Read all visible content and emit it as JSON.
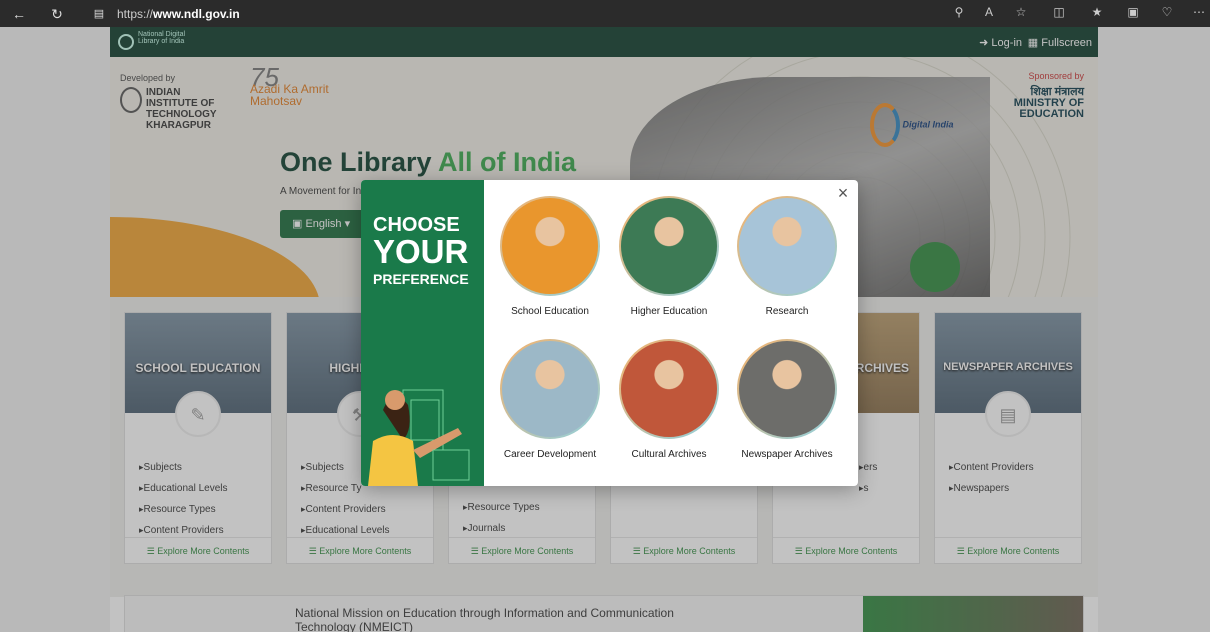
{
  "browser": {
    "url_prefix": "https://",
    "url_domain": "www.ndl.gov.in"
  },
  "topbar": {
    "logo_text": "National Digital Library of India",
    "login": "Log-in",
    "fullscreen": "Fullscreen"
  },
  "hero": {
    "developed_by": "Developed by",
    "iit_name": "INDIAN INSTITUTE OF TECHNOLOGY KHARAGPUR",
    "azadi_num": "75",
    "azadi_text": "Azadi Ka Amrit Mahotsav",
    "digital_india": "Digital India",
    "sponsored_by": "Sponsored by",
    "ministry": "शिक्षा मंत्रालय MINISTRY OF EDUCATION",
    "headline_a": "One Library ",
    "headline_b": "All of India",
    "subline": "A Movement for In",
    "language": "English"
  },
  "cards": [
    {
      "title": "SCHOOL EDUCATION",
      "links": [
        "Subjects",
        "Educational Levels",
        "Resource Types",
        "Content Providers"
      ],
      "explore": "Explore More Contents"
    },
    {
      "title": "HIGHER EI",
      "links": [
        "Subjects",
        "Resource Ty",
        "Content Providers",
        "Educational Levels"
      ],
      "explore": "Explore More Contents"
    },
    {
      "title": "",
      "links": [
        "",
        "",
        "Resource Types",
        "Journals"
      ],
      "explore": "Explore More Contents"
    },
    {
      "title": "",
      "links": [],
      "explore": "Explore More Contents"
    },
    {
      "title": "RCHIVES",
      "links": [
        "ers",
        "s"
      ],
      "explore": "Explore More Contents"
    },
    {
      "title": "NEWSPAPER ARCHIVES",
      "links": [
        "Content Providers",
        "Newspapers"
      ],
      "explore": "Explore More Contents"
    }
  ],
  "nmeict": {
    "text": "National Mission on Education through Information and Communication Technology (NMEICT)"
  },
  "modal": {
    "choose_1": "CHOOSE",
    "choose_2": "YOUR",
    "choose_3": "PREFERENCE",
    "close": "×",
    "options": [
      {
        "label": "School Education",
        "color": "#e9962d"
      },
      {
        "label": "Higher Education",
        "color": "#3d7a55"
      },
      {
        "label": "Research",
        "color": "#a7c4d8"
      },
      {
        "label": "Career Development",
        "color": "#9cb8c7"
      },
      {
        "label": "Cultural Archives",
        "color": "#c0573a"
      },
      {
        "label": "Newspaper Archives",
        "color": "#6d6d6a"
      }
    ]
  }
}
